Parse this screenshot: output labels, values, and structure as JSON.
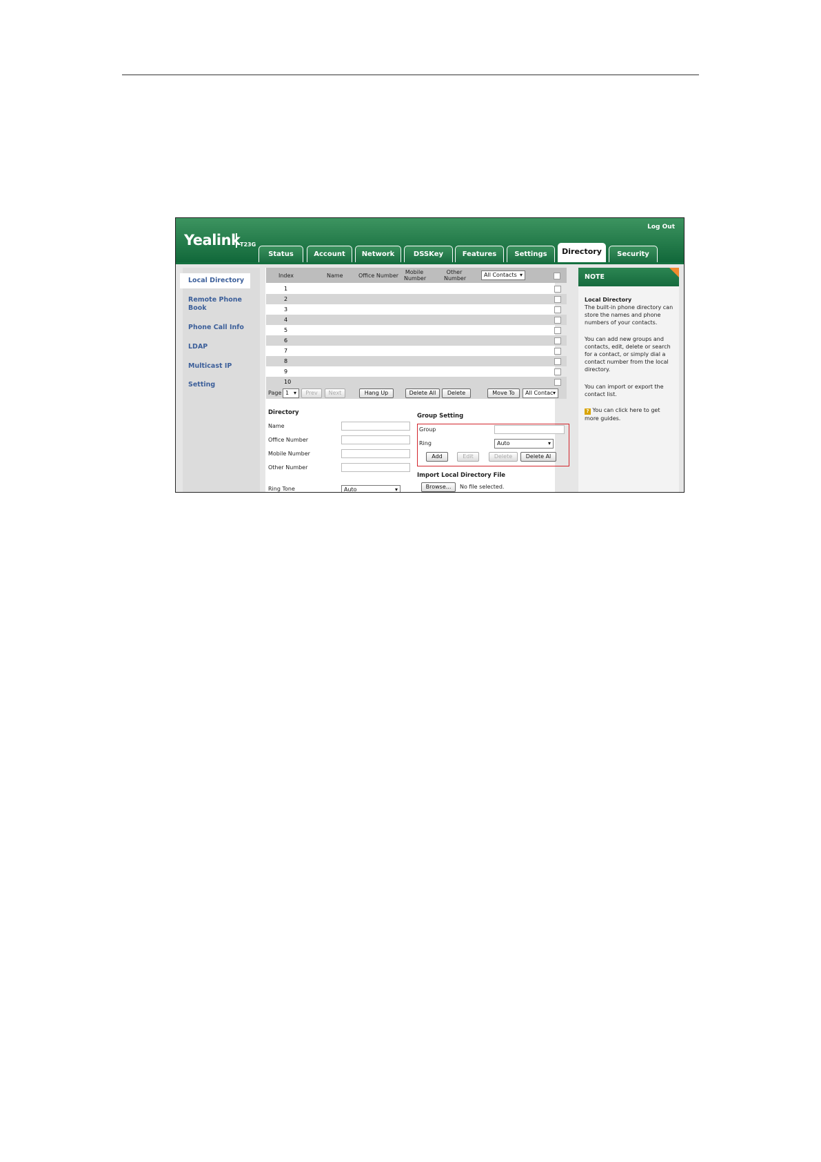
{
  "app": {
    "logo": "Yealink",
    "model": "T23G",
    "logout": "Log Out"
  },
  "tabs": [
    "Status",
    "Account",
    "Network",
    "DSSKey",
    "Features",
    "Settings",
    "Directory",
    "Security"
  ],
  "active_tab": "Directory",
  "sidebar": {
    "items": [
      "Local Directory",
      "Remote Phone Book",
      "Phone Call Info",
      "LDAP",
      "Multicast IP",
      "Setting"
    ]
  },
  "table": {
    "headers": [
      "Index",
      "Name",
      "Office Number",
      "Mobile Number",
      "Other Number"
    ],
    "filter_select": "All Contacts",
    "rows": [
      "1",
      "2",
      "3",
      "4",
      "5",
      "6",
      "7",
      "8",
      "9",
      "10"
    ]
  },
  "pager": {
    "page_label": "Page",
    "page_value": "1",
    "prev": "Prev",
    "next": "Next",
    "hang_up": "Hang Up",
    "delete_all": "Delete All",
    "delete": "Delete",
    "move_to": "Move To",
    "move_to_select": "All Contac"
  },
  "directory_form": {
    "title": "Directory",
    "name": "Name",
    "office_number": "Office Number",
    "mobile_number": "Mobile Number",
    "other_number": "Other Number",
    "ring_tone": "Ring Tone",
    "ring_tone_value": "Auto"
  },
  "group_setting": {
    "title": "Group Setting",
    "group": "Group",
    "ring": "Ring",
    "ring_value": "Auto",
    "add": "Add",
    "edit": "Edit",
    "delete": "Delete",
    "delete_all": "Delete Al"
  },
  "import": {
    "title": "Import Local Directory File",
    "browse": "Browse...",
    "no_file": "No file selected."
  },
  "note": {
    "header": "NOTE",
    "title": "Local Directory",
    "p1": "The built-in phone directory can store the names and phone numbers of your contacts.",
    "p2": "You can add new groups and contacts, edit, delete or search for a contact, or simply dial a contact number from the local directory.",
    "p3": "You can import or export the contact list.",
    "p4": "You can click here to get more guides."
  },
  "colors": {
    "brand_green": "#11683a",
    "highlight_red": "#d2232a",
    "link_blue": "#3c5f9a"
  }
}
